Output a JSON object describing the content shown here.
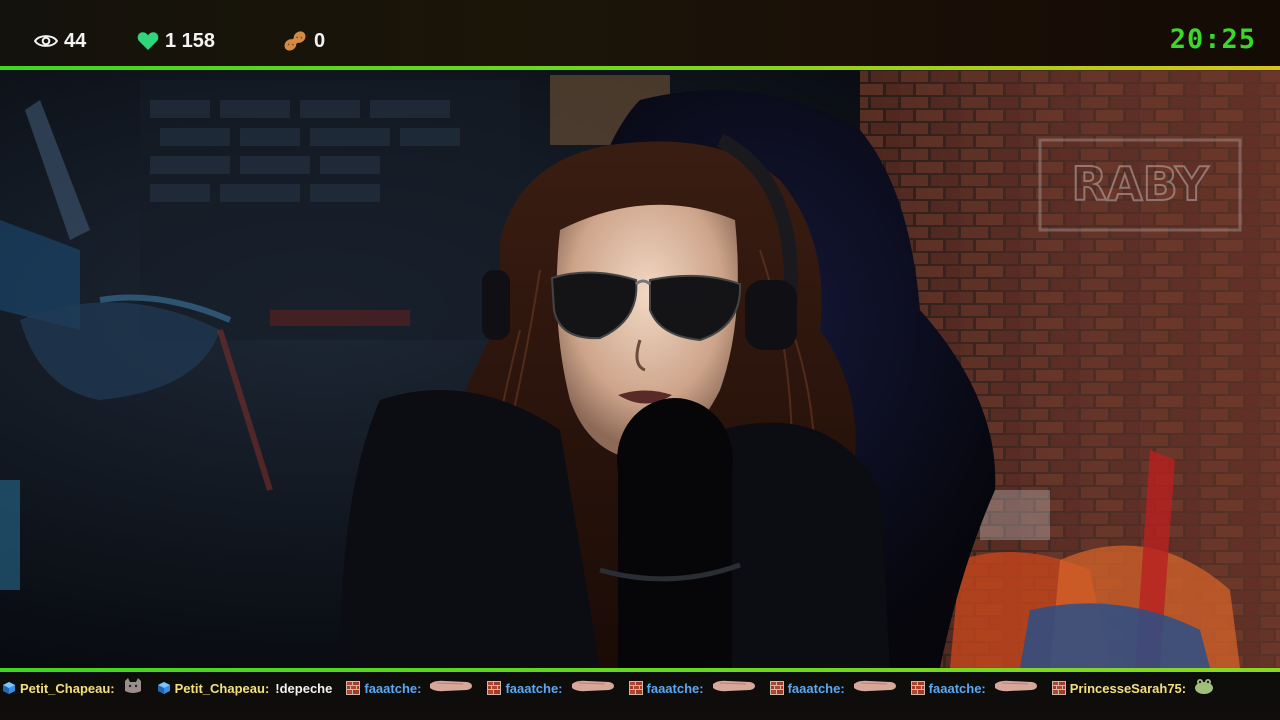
{
  "stats": {
    "viewers": "44",
    "likes": "1 158",
    "peanuts": "0"
  },
  "clock": "20:25",
  "colors": {
    "accent_green": "#39d82b",
    "heart": "#2fd67a",
    "peanut": "#d38a45"
  },
  "chat": [
    {
      "badge": "cube-badge-icon",
      "user": "Petit_Chapeau:",
      "user_color": "#f4e07a",
      "text": "",
      "emote": "cat-emote"
    },
    {
      "badge": "cube-badge-icon",
      "user": "Petit_Chapeau:",
      "user_color": "#f4e07a",
      "text": "!depeche",
      "emote": ""
    },
    {
      "badge": "brick-badge-icon",
      "user": "faaatche:",
      "user_color": "#5aa9f5",
      "text": "",
      "emote": "hand-emote"
    },
    {
      "badge": "brick-badge-icon",
      "user": "faaatche:",
      "user_color": "#5aa9f5",
      "text": "",
      "emote": "hand-emote"
    },
    {
      "badge": "brick-badge-icon",
      "user": "faaatche:",
      "user_color": "#5aa9f5",
      "text": "",
      "emote": "hand-emote"
    },
    {
      "badge": "brick-badge-icon",
      "user": "faaatche:",
      "user_color": "#5aa9f5",
      "text": "",
      "emote": "hand-emote"
    },
    {
      "badge": "brick-badge-icon",
      "user": "faaatche:",
      "user_color": "#5aa9f5",
      "text": "",
      "emote": "hand-emote"
    },
    {
      "badge": "brick-badge-icon",
      "user": "PrincesseSarah75:",
      "user_color": "#f4e07a",
      "text": "",
      "emote": "frog-emote"
    }
  ]
}
